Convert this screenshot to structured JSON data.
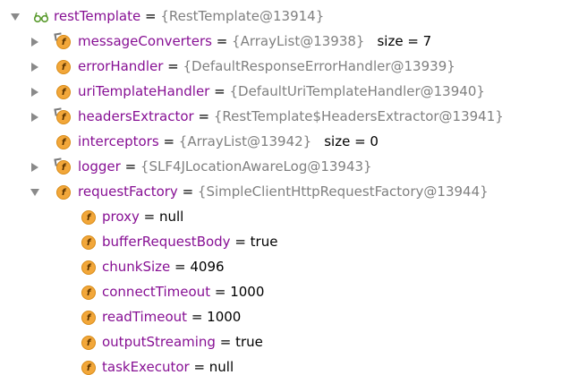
{
  "tree": {
    "root": {
      "name": "restTemplate",
      "eq": " = ",
      "value": "{RestTemplate@13914}"
    },
    "children": [
      {
        "name": "messageConverters",
        "eq": " = ",
        "value": "{ArrayList@13938}",
        "extra": "size = 7",
        "expandable": true,
        "final": true
      },
      {
        "name": "errorHandler",
        "eq": " = ",
        "value": "{DefaultResponseErrorHandler@13939}",
        "extra": "",
        "expandable": true,
        "final": false
      },
      {
        "name": "uriTemplateHandler",
        "eq": " = ",
        "value": "{DefaultUriTemplateHandler@13940}",
        "extra": "",
        "expandable": true,
        "final": false
      },
      {
        "name": "headersExtractor",
        "eq": " = ",
        "value": "{RestTemplate$HeadersExtractor@13941}",
        "extra": "",
        "expandable": true,
        "final": true
      },
      {
        "name": "interceptors",
        "eq": " = ",
        "value": "{ArrayList@13942}",
        "extra": "size = 0",
        "expandable": false,
        "final": false
      },
      {
        "name": "logger",
        "eq": " = ",
        "value": "{SLF4JLocationAwareLog@13943}",
        "extra": "",
        "expandable": true,
        "final": true
      },
      {
        "name": "requestFactory",
        "eq": " = ",
        "value": "{SimpleClientHttpRequestFactory@13944}",
        "extra": "",
        "expandable": true,
        "expanded": true,
        "final": false
      }
    ],
    "requestFactory_children": [
      {
        "name": "proxy",
        "eq": " = ",
        "value": "null"
      },
      {
        "name": "bufferRequestBody",
        "eq": " = ",
        "value": "true"
      },
      {
        "name": "chunkSize",
        "eq": " = ",
        "value": "4096"
      },
      {
        "name": "connectTimeout",
        "eq": " = ",
        "value": "1000"
      },
      {
        "name": "readTimeout",
        "eq": " = ",
        "value": "1000"
      },
      {
        "name": "outputStreaming",
        "eq": " = ",
        "value": "true"
      },
      {
        "name": "taskExecutor",
        "eq": " = ",
        "value": "null"
      }
    ],
    "field_icon_letter": "f",
    "icons": {
      "root": "watch-glasses-icon",
      "field": "field-icon",
      "final_field": "final-field-icon",
      "collapsed": "chevron-right-icon",
      "expanded": "chevron-down-icon"
    },
    "colors": {
      "name": "#871094",
      "object_value": "#808080",
      "primitive_value": "#000000",
      "field_icon": "#f2a73a"
    }
  }
}
